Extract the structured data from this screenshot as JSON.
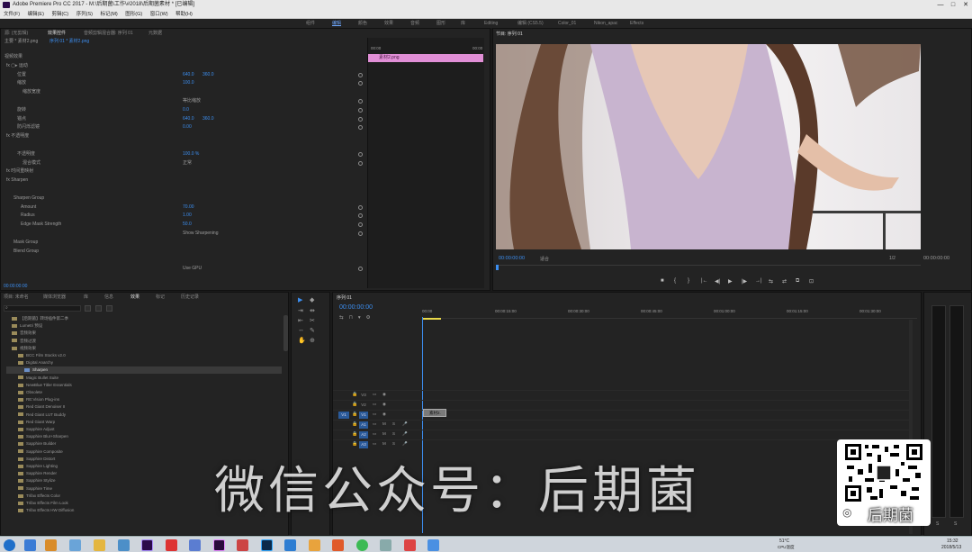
{
  "window": {
    "title": "Adobe Premiere Pro CC 2017 - M:\\后期菌\\工作\\#2018\\后期菌素材 * [已编辑]",
    "controls": [
      "—",
      "□",
      "✕"
    ]
  },
  "menu": [
    "文件(F)",
    "编辑(E)",
    "剪辑(C)",
    "序列(S)",
    "标记(M)",
    "图形(G)",
    "窗口(W)",
    "帮助(H)"
  ],
  "workspaces": [
    "组件",
    "编辑",
    "颜色",
    "效果",
    "音频",
    "图形",
    "库",
    "Editing",
    "编辑 (CS5.5)",
    "Color_01",
    "Nikon_apac",
    "Effects"
  ],
  "effect_controls": {
    "tabs": [
      "源: (无剪辑)",
      "效果控件",
      "音频剪辑混合器: 序列 01",
      "元数据"
    ],
    "breadcrumb": [
      "主要 * 素材2.png",
      "序列 01 * 素材2.png"
    ],
    "clip_label": "素材2.png",
    "ruler": [
      "00:00",
      "00:00"
    ],
    "rows": [
      {
        "label": "视频效果",
        "indent": 4,
        "values": []
      },
      {
        "label": "fx ▢▸ 运动",
        "indent": 6,
        "values": []
      },
      {
        "label": "位置",
        "indent": 18,
        "values": [
          "640.0",
          "360.0"
        ]
      },
      {
        "label": "缩放",
        "indent": 18,
        "values": [
          "100.0"
        ]
      },
      {
        "label": "缩放宽度",
        "indent": 24,
        "values": []
      },
      {
        "label": "",
        "indent": 18,
        "values": [
          "等比缩放"
        ]
      },
      {
        "label": "旋转",
        "indent": 18,
        "values": [
          "0.0"
        ]
      },
      {
        "label": "锚点",
        "indent": 18,
        "values": [
          "640.0",
          "360.0"
        ]
      },
      {
        "label": "防闪烁滤镜",
        "indent": 18,
        "values": [
          "0.00"
        ]
      },
      {
        "label": "fx 不透明度",
        "indent": 6,
        "values": []
      },
      {
        "label": "",
        "indent": 18,
        "values": []
      },
      {
        "label": "不透明度",
        "indent": 18,
        "values": [
          "100.0 %"
        ]
      },
      {
        "label": "混合模式",
        "indent": 24,
        "values": [
          "正常"
        ]
      },
      {
        "label": "fx 时间重映射",
        "indent": 6,
        "values": []
      },
      {
        "label": "fx Sharpen",
        "indent": 6,
        "values": []
      },
      {
        "label": "",
        "indent": 14,
        "values": []
      },
      {
        "label": "Sharpen Group",
        "indent": 14,
        "values": []
      },
      {
        "label": "Amount",
        "indent": 22,
        "values": [
          "70.00"
        ]
      },
      {
        "label": "Radius",
        "indent": 22,
        "values": [
          "1.00"
        ]
      },
      {
        "label": "Edge Mask Strength",
        "indent": 22,
        "values": [
          "50.0"
        ]
      },
      {
        "label": "",
        "indent": 22,
        "values": [
          "Show Sharpening"
        ]
      },
      {
        "label": "Mask Group",
        "indent": 14,
        "values": []
      },
      {
        "label": "Blend Group",
        "indent": 14,
        "values": []
      },
      {
        "label": "",
        "indent": 22,
        "values": []
      },
      {
        "label": "",
        "indent": 22,
        "values": [
          "Use GPU"
        ]
      }
    ],
    "timecode": "00:00:00:00"
  },
  "program": {
    "title": "节目: 序列 01",
    "timecode_left": "00:00:00:00",
    "zoom": "适合",
    "fraction": "1/2",
    "timecode_right": "00:00:00:00",
    "controls": [
      "■",
      "{",
      "}",
      "|←",
      "◀|",
      "▶",
      "|▶",
      "→|",
      "⇆",
      "⇄",
      "⧉",
      "⊡"
    ]
  },
  "project": {
    "tabs": [
      "项目: 未命名",
      "媒体浏览器",
      "库",
      "信息",
      "效果",
      "标记",
      "历史记录"
    ],
    "items": [
      "【后期菌】转场插件第二季",
      "Lumetri 预设",
      "音频效果",
      "音频过渡",
      "视频效果",
      "BCC Film Stocks v2.0",
      "Digital Anarchy",
      "Sharpen",
      "Magic Bullet Suite",
      "NewBlue Titler Essentials",
      "Obsolete",
      "RE:Vision Plug-ins",
      "Red Giant Denoiser II",
      "Red Giant LUT Buddy",
      "Red Giant Warp",
      "Sapphire Adjust",
      "Sapphire Blur+Sharpen",
      "Sapphire Builder",
      "Sapphire Composite",
      "Sapphire Distort",
      "Sapphire Lighting",
      "Sapphire Render",
      "Sapphire Stylize",
      "Sapphire Time",
      "Trifax Effects Color",
      "Trifax Effects Film Look",
      "Trifax Effects HW Diffusion"
    ]
  },
  "timeline": {
    "title": "序列 01",
    "timecode": "00:00:00:00",
    "ruler": [
      "00:00",
      "00:00:15:00",
      "00:00:30:00",
      "00:00:45:00",
      "00:01:00:00",
      "00:01:15:00",
      "00:01:30:00"
    ],
    "tracks": [
      {
        "name": "V3",
        "type": "video"
      },
      {
        "name": "V2",
        "type": "video"
      },
      {
        "name": "V1",
        "type": "video"
      },
      {
        "name": "A1",
        "type": "audio"
      },
      {
        "name": "A2",
        "type": "audio"
      },
      {
        "name": "A3",
        "type": "audio"
      }
    ],
    "clip": "素材2.",
    "src_v": "V1",
    "meter_labels": [
      "S",
      "S"
    ]
  },
  "overlay": {
    "watermark": "微信公众号：后期菌",
    "qr_caption": "后期菌"
  },
  "taskbar": {
    "time": "15:32",
    "date": "2018/5/13",
    "temp": "51°C",
    "cpu_label": "CPU温度"
  },
  "colors": {
    "accent": "#3c8ef0",
    "clip_pink": "#e18fd6",
    "panel": "#232323",
    "playhead": "#e8d84a"
  }
}
